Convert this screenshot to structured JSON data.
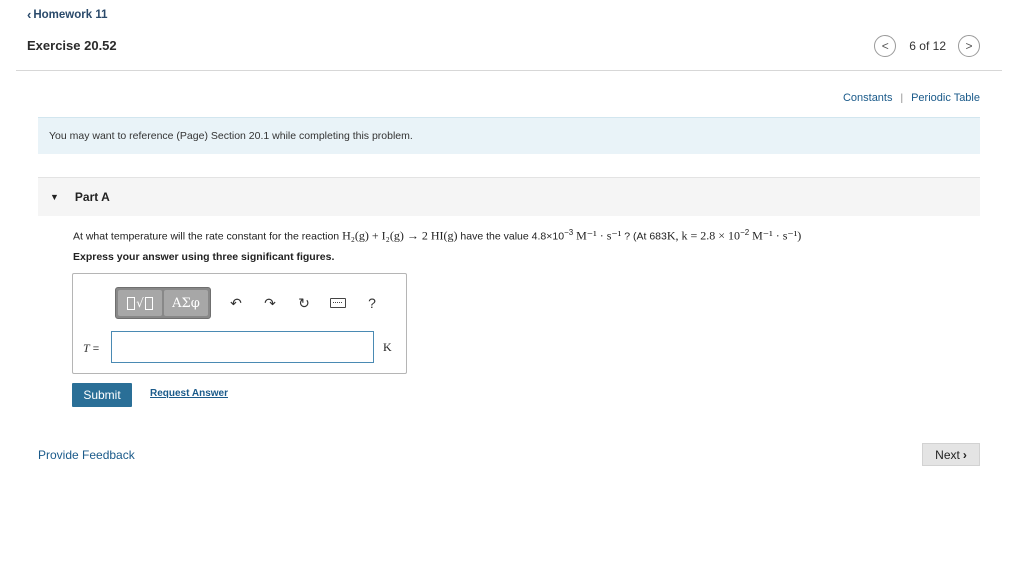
{
  "nav": {
    "back_label": "Homework 11",
    "title": "Exercise 20.52",
    "pager_text": "6 of 12"
  },
  "links": {
    "constants": "Constants",
    "separator": "|",
    "periodic_table": "Periodic Table"
  },
  "reference_text": "You may want to reference (Page) Section 20.1 while completing this problem.",
  "part": {
    "label": "Part A",
    "question_intro": "At what temperature will the rate constant for the reaction",
    "reaction": "H₂(g) + I₂(g) → 2 HI(g)",
    "question_mid": "have the value 4.8×10",
    "value_exp": "−3",
    "value_units": "M⁻¹ · s⁻¹",
    "question_q": "? (At 683",
    "given_k": "K, k = 2.8 × 10",
    "given_exp": "−2",
    "given_units": "M⁻¹ · s⁻¹)",
    "instruction": "Express your answer using three significant figures."
  },
  "answer": {
    "variable": "T",
    "equals": "=",
    "value": "",
    "unit": "K"
  },
  "toolbar": {
    "greek_label": "ΑΣφ",
    "help_label": "?"
  },
  "actions": {
    "submit_label": "Submit",
    "request_label": "Request Answer",
    "feedback_label": "Provide Feedback",
    "next_label": "Next"
  },
  "colors": {
    "primary_button": "#2a6f97",
    "link": "#1a5a8a",
    "reference_bg": "#e9f3f8"
  }
}
